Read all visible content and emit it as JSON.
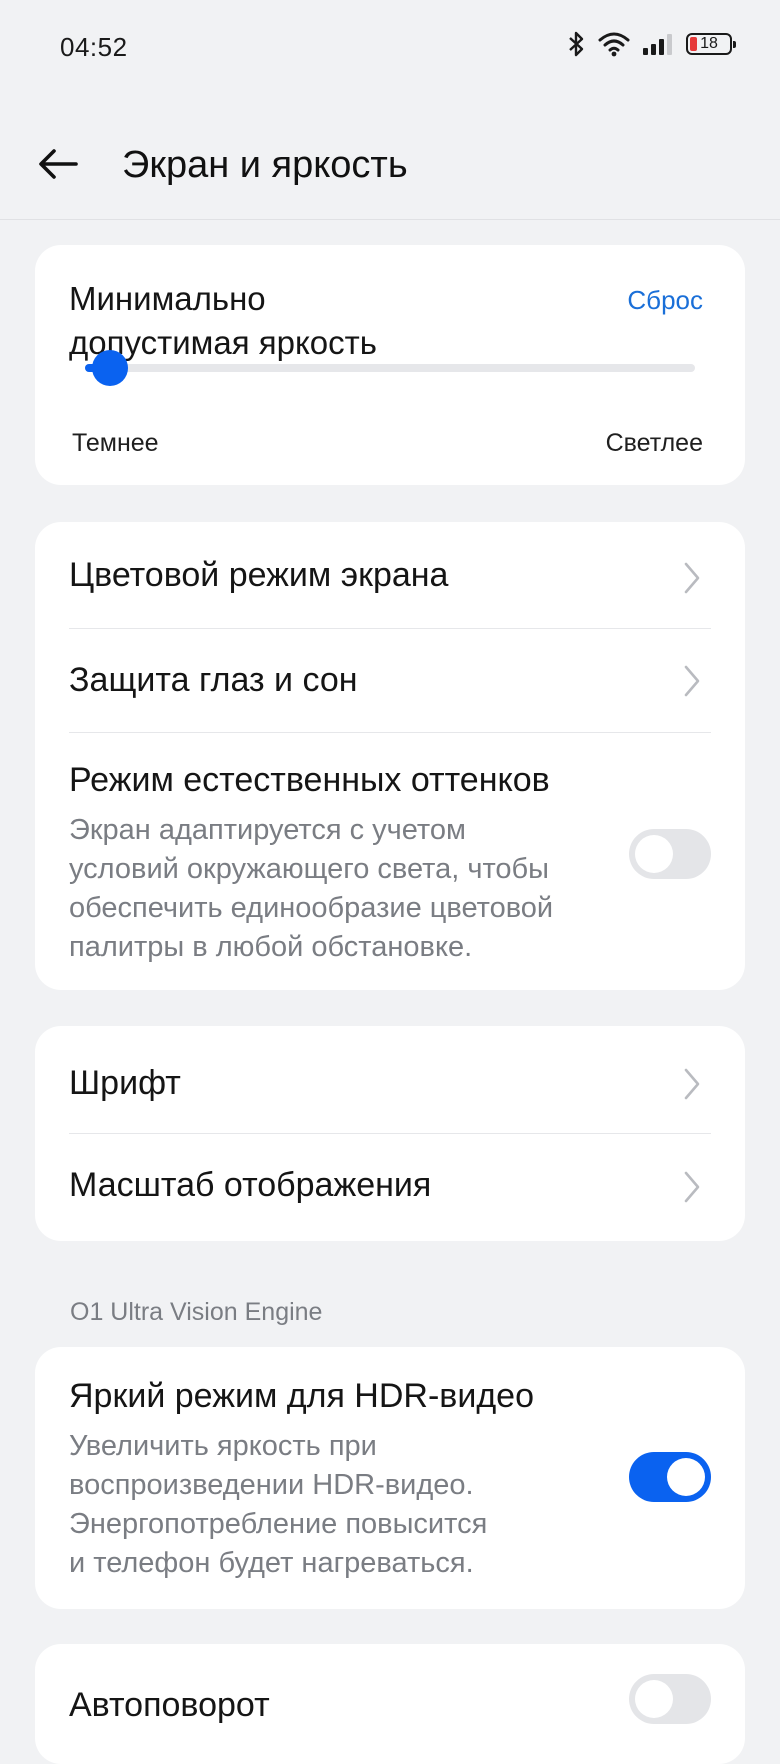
{
  "status_bar": {
    "time": "04:52",
    "battery_level": "18",
    "icons": [
      "bluetooth-icon",
      "wifi-icon",
      "signal-icon",
      "battery-icon"
    ]
  },
  "header": {
    "title": "Экран и яркость",
    "back_icon": "arrow-left-icon"
  },
  "brightness": {
    "title_line1": "Минимально",
    "title_line2": "допустимая яркость",
    "reset_label": "Сброс",
    "min_label": "Темнее",
    "max_label": "Светлее",
    "slider_value_fraction": 0.04
  },
  "display_group": {
    "color_mode_label": "Цветовой режим экрана",
    "eye_protection_label": "Защита глаз и сон",
    "natural_tone": {
      "title": "Режим естественных оттенков",
      "desc_lines": [
        "Экран адаптируется с учетом",
        "условий окружающего света, чтобы",
        "обеспечить единообразие цветовой",
        "палитры в любой обстановке."
      ],
      "enabled": false
    }
  },
  "font_group": {
    "font_label": "Шрифт",
    "scale_label": "Масштаб отображения"
  },
  "section_label": "O1 Ultra Vision Engine",
  "hdr": {
    "title": "Яркий режим для HDR-видео",
    "desc_lines": [
      "Увеличить яркость при",
      "воспроизведении HDR-видео.",
      "Энергопотребление повысится",
      "и телефон будет нагреваться."
    ],
    "enabled": true
  },
  "autorotate": {
    "title": "Автоповорот",
    "enabled": false
  },
  "colors": {
    "accent": "#0a62f0",
    "link": "#1a6fd8",
    "background": "#f1f2f4",
    "card": "#ffffff",
    "secondary_text": "#7a7d83",
    "battery_low": "#e63a3a"
  }
}
